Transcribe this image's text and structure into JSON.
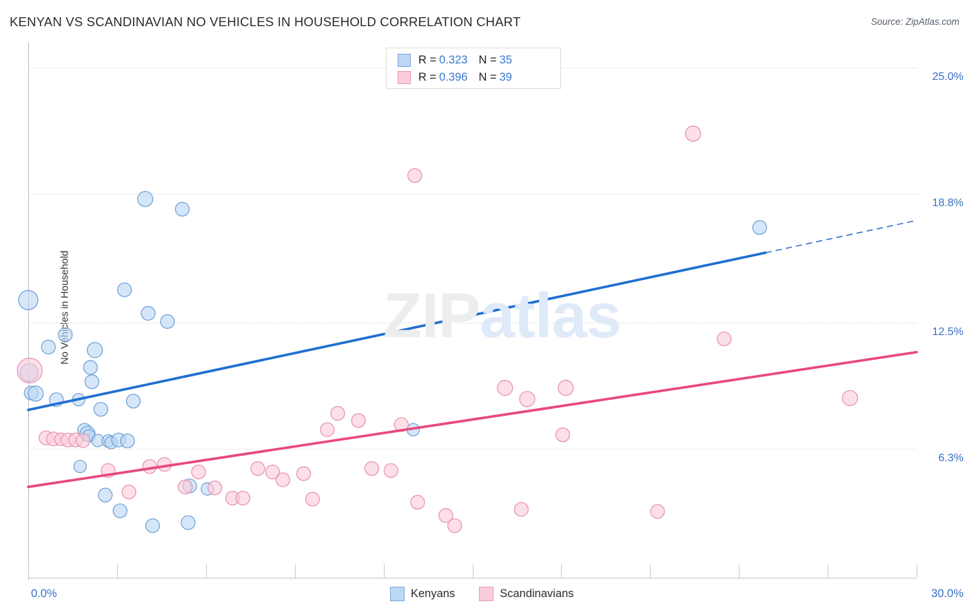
{
  "header": {
    "title": "KENYAN VS SCANDINAVIAN NO VEHICLES IN HOUSEHOLD CORRELATION CHART",
    "source": "Source: ZipAtlas.com"
  },
  "watermark": {
    "part1": "ZIP",
    "part2": "atlas"
  },
  "correlation_legend": {
    "rows": [
      {
        "series": "Kenyans",
        "r_label": "R =",
        "r_value": "0.323",
        "n_label": "N =",
        "n_value": "35",
        "color": "#bdd7f5"
      },
      {
        "series": "Scandinavians",
        "r_label": "R =",
        "r_value": "0.396",
        "n_label": "N =",
        "n_value": "39",
        "color": "#fbccd9"
      }
    ]
  },
  "series_legend": [
    {
      "label": "Kenyans",
      "color": "#bdd7f5"
    },
    {
      "label": "Scandinavians",
      "color": "#fbccd9"
    }
  ],
  "axes": {
    "y_title": "No Vehicles in Household",
    "y_ticks": [
      "25.0%",
      "18.8%",
      "12.5%",
      "6.3%"
    ],
    "x_min": "0.0%",
    "x_max": "30.0%"
  },
  "chart_data": {
    "type": "scatter",
    "title": "KENYAN VS SCANDINAVIAN NO VEHICLES IN HOUSEHOLD CORRELATION CHART",
    "xlabel": "",
    "ylabel": "No Vehicles in Household",
    "xlim": [
      0.0,
      30.0
    ],
    "ylim": [
      0.0,
      26.1
    ],
    "x_tick_labels": [
      "0.0%",
      "30.0%"
    ],
    "y_tick_labels": [
      "6.3%",
      "12.5%",
      "18.8%",
      "25.0%"
    ],
    "y_tick_values": [
      6.3,
      12.5,
      18.8,
      25.0
    ],
    "grid": "horizontal-dashed",
    "legend_position": "bottom-center",
    "series": [
      {
        "name": "Kenyans",
        "color": "#bdd7f5",
        "edge_color": "#6d9fd4",
        "r": 0.323,
        "n": 35,
        "trend": {
          "x0": 0.0,
          "y0": 8.22,
          "x1": 24.9,
          "y1": 15.92,
          "solid_to_x": 24.9,
          "dashed_to_x": 30.0,
          "dashed_y": 17.5
        },
        "points": [
          {
            "x": 0.0,
            "y": 13.6,
            "r": 14
          },
          {
            "x": 0.03,
            "y": 10.05,
            "r": 13
          },
          {
            "x": 0.1,
            "y": 9.05,
            "r": 10
          },
          {
            "x": 0.25,
            "y": 9.02,
            "r": 11
          },
          {
            "x": 0.68,
            "y": 11.3,
            "r": 10
          },
          {
            "x": 0.95,
            "y": 8.72,
            "r": 10
          },
          {
            "x": 1.25,
            "y": 11.9,
            "r": 10
          },
          {
            "x": 1.7,
            "y": 8.72,
            "r": 9
          },
          {
            "x": 1.75,
            "y": 5.45,
            "r": 9
          },
          {
            "x": 1.9,
            "y": 7.22,
            "r": 10
          },
          {
            "x": 2.0,
            "y": 7.05,
            "r": 11
          },
          {
            "x": 2.05,
            "y": 6.95,
            "r": 9
          },
          {
            "x": 2.1,
            "y": 10.3,
            "r": 10
          },
          {
            "x": 2.15,
            "y": 9.6,
            "r": 10
          },
          {
            "x": 2.25,
            "y": 11.15,
            "r": 11
          },
          {
            "x": 2.35,
            "y": 6.72,
            "r": 9
          },
          {
            "x": 2.45,
            "y": 8.25,
            "r": 10
          },
          {
            "x": 2.6,
            "y": 4.05,
            "r": 10
          },
          {
            "x": 2.7,
            "y": 6.7,
            "r": 9
          },
          {
            "x": 2.8,
            "y": 6.62,
            "r": 9
          },
          {
            "x": 3.05,
            "y": 6.75,
            "r": 10
          },
          {
            "x": 3.1,
            "y": 3.28,
            "r": 10
          },
          {
            "x": 3.25,
            "y": 14.1,
            "r": 10
          },
          {
            "x": 3.35,
            "y": 6.7,
            "r": 10
          },
          {
            "x": 3.55,
            "y": 8.65,
            "r": 10
          },
          {
            "x": 3.95,
            "y": 18.55,
            "r": 11
          },
          {
            "x": 4.05,
            "y": 12.95,
            "r": 10
          },
          {
            "x": 4.2,
            "y": 2.55,
            "r": 10
          },
          {
            "x": 4.7,
            "y": 12.55,
            "r": 10
          },
          {
            "x": 5.2,
            "y": 18.05,
            "r": 10
          },
          {
            "x": 5.4,
            "y": 2.7,
            "r": 10
          },
          {
            "x": 5.45,
            "y": 4.5,
            "r": 10
          },
          {
            "x": 6.05,
            "y": 4.35,
            "r": 9
          },
          {
            "x": 13.0,
            "y": 7.25,
            "r": 9
          },
          {
            "x": 24.7,
            "y": 17.15,
            "r": 10
          }
        ]
      },
      {
        "name": "Scandinavians",
        "color": "#fbccd9",
        "edge_color": "#e58fae",
        "r": 0.396,
        "n": 39,
        "trend": {
          "x0": 0.0,
          "y0": 4.45,
          "x1": 30.0,
          "y1": 11.05
        },
        "points": [
          {
            "x": 0.05,
            "y": 10.15,
            "r": 18
          },
          {
            "x": 0.6,
            "y": 6.85,
            "r": 10
          },
          {
            "x": 0.85,
            "y": 6.8,
            "r": 10
          },
          {
            "x": 1.1,
            "y": 6.78,
            "r": 9
          },
          {
            "x": 1.35,
            "y": 6.75,
            "r": 10
          },
          {
            "x": 1.6,
            "y": 6.75,
            "r": 10
          },
          {
            "x": 1.85,
            "y": 6.72,
            "r": 10
          },
          {
            "x": 2.7,
            "y": 5.25,
            "r": 10
          },
          {
            "x": 3.4,
            "y": 4.2,
            "r": 10
          },
          {
            "x": 4.1,
            "y": 5.45,
            "r": 10
          },
          {
            "x": 4.6,
            "y": 5.55,
            "r": 10
          },
          {
            "x": 5.3,
            "y": 4.45,
            "r": 10
          },
          {
            "x": 5.75,
            "y": 5.18,
            "r": 10
          },
          {
            "x": 6.3,
            "y": 4.4,
            "r": 10
          },
          {
            "x": 6.9,
            "y": 3.9,
            "r": 10
          },
          {
            "x": 7.25,
            "y": 3.9,
            "r": 10
          },
          {
            "x": 7.75,
            "y": 5.35,
            "r": 10
          },
          {
            "x": 8.25,
            "y": 5.18,
            "r": 10
          },
          {
            "x": 8.6,
            "y": 4.8,
            "r": 10
          },
          {
            "x": 9.3,
            "y": 5.1,
            "r": 10
          },
          {
            "x": 9.6,
            "y": 3.85,
            "r": 10
          },
          {
            "x": 10.1,
            "y": 7.25,
            "r": 10
          },
          {
            "x": 10.45,
            "y": 8.05,
            "r": 10
          },
          {
            "x": 11.15,
            "y": 7.7,
            "r": 10
          },
          {
            "x": 11.6,
            "y": 5.35,
            "r": 10
          },
          {
            "x": 12.25,
            "y": 5.25,
            "r": 10
          },
          {
            "x": 12.6,
            "y": 7.5,
            "r": 10
          },
          {
            "x": 13.05,
            "y": 19.7,
            "r": 10
          },
          {
            "x": 13.15,
            "y": 3.7,
            "r": 10
          },
          {
            "x": 14.1,
            "y": 3.05,
            "r": 10
          },
          {
            "x": 14.4,
            "y": 2.55,
            "r": 10
          },
          {
            "x": 16.1,
            "y": 9.3,
            "r": 11
          },
          {
            "x": 16.65,
            "y": 3.35,
            "r": 10
          },
          {
            "x": 16.85,
            "y": 8.75,
            "r": 11
          },
          {
            "x": 18.15,
            "y": 9.3,
            "r": 11
          },
          {
            "x": 18.05,
            "y": 7.0,
            "r": 10
          },
          {
            "x": 21.25,
            "y": 3.25,
            "r": 10
          },
          {
            "x": 22.45,
            "y": 21.75,
            "r": 11
          },
          {
            "x": 23.5,
            "y": 11.7,
            "r": 10
          },
          {
            "x": 27.75,
            "y": 8.8,
            "r": 11
          }
        ]
      }
    ]
  }
}
